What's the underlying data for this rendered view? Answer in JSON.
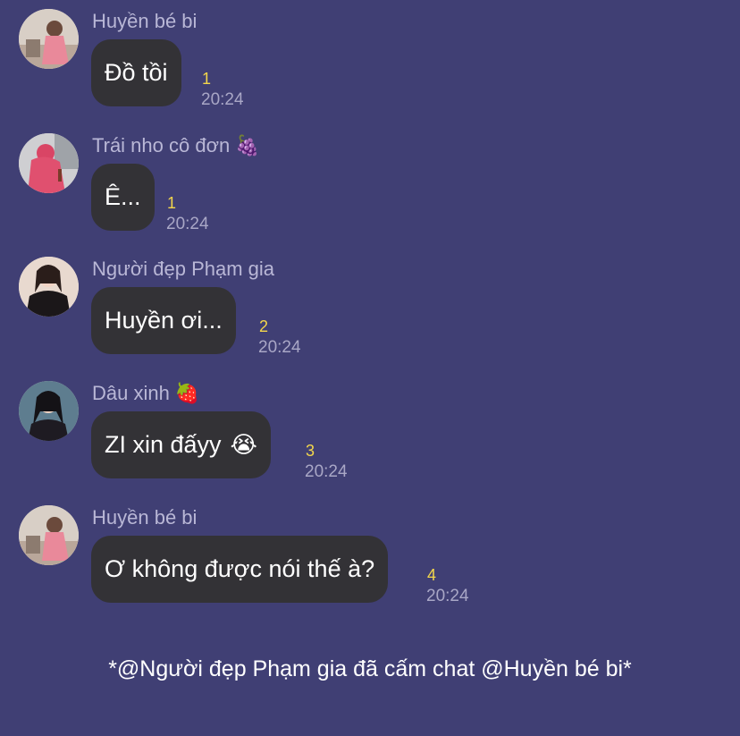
{
  "messages": [
    {
      "sender": "Huyền bé bi",
      "sender_emoji": "",
      "text": "Đồ tồi",
      "text_emoji": "",
      "count": "1",
      "time": "20:24"
    },
    {
      "sender": "Trái nho cô đơn",
      "sender_emoji": "🍇",
      "text": "Ê...",
      "text_emoji": "",
      "count": "1",
      "time": "20:24"
    },
    {
      "sender": "Người đẹp Phạm gia",
      "sender_emoji": "",
      "text": "Huyền ơi...",
      "text_emoji": "",
      "count": "2",
      "time": "20:24"
    },
    {
      "sender": "Dâu xinh",
      "sender_emoji": "🍓",
      "text": "ZI xin đấyy",
      "text_emoji": "😭",
      "count": "3",
      "time": "20:24"
    },
    {
      "sender": "Huyền bé bi",
      "sender_emoji": "",
      "text": "Ơ không được nói thế à?",
      "text_emoji": "",
      "count": "4",
      "time": "20:24"
    }
  ],
  "system_message": "*@Người đẹp Phạm gia đã cấm chat @Huyền bé bi*",
  "colors": {
    "background": "#403f74",
    "bubble": "#333236",
    "count": "#f3d64b",
    "sender": "#b9b7d6",
    "time": "#a9a7c6"
  }
}
